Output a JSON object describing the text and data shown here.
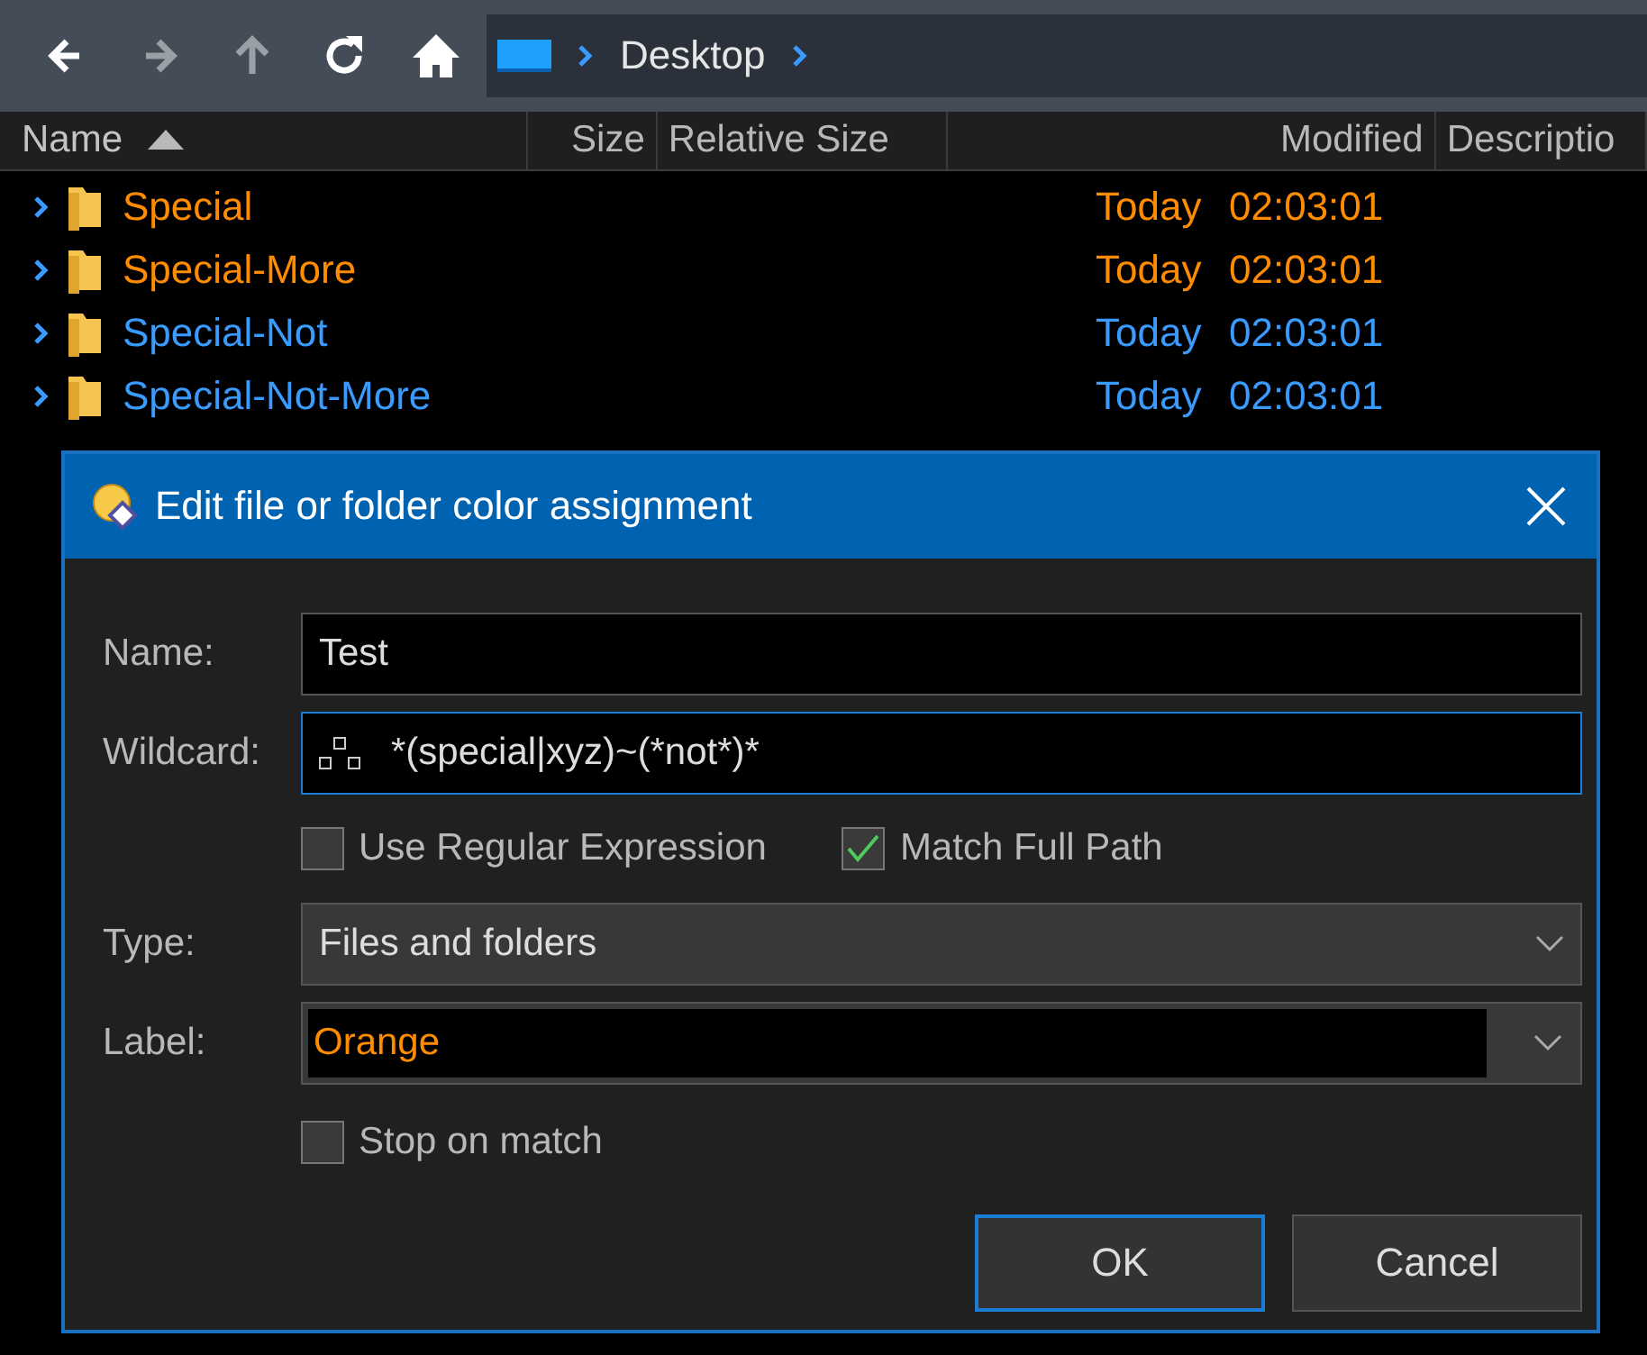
{
  "toolbar": {
    "buttons": [
      {
        "kind": "back",
        "disabled": false
      },
      {
        "kind": "forward",
        "disabled": true
      },
      {
        "kind": "up",
        "disabled": true
      },
      {
        "kind": "refresh",
        "disabled": false
      },
      {
        "kind": "home",
        "disabled": false
      }
    ],
    "breadcrumb": [
      "Desktop"
    ]
  },
  "file_list": {
    "columns": [
      {
        "label": "Name",
        "sorted": true
      },
      {
        "label": "Size",
        "sorted": false
      },
      {
        "label": "Relative Size",
        "sorted": false
      },
      {
        "label": "Modified",
        "sorted": false
      },
      {
        "label": "Descriptio",
        "sorted": false
      }
    ],
    "rows": [
      {
        "name": "Special",
        "day": "Today",
        "time": "02:03:01",
        "color": "#ff8c00"
      },
      {
        "name": "Special-More",
        "day": "Today",
        "time": "02:03:01",
        "color": "#ff8c00"
      },
      {
        "name": "Special-Not",
        "day": "Today",
        "time": "02:03:01",
        "color": "#3a9bff"
      },
      {
        "name": "Special-Not-More",
        "day": "Today",
        "time": "02:03:01",
        "color": "#3a9bff"
      }
    ]
  },
  "dialog": {
    "title": "Edit file or folder color assignment",
    "name_field": {
      "label": "Name:",
      "value": "Test",
      "focused": false
    },
    "wildcard_field": {
      "label": "Wildcard:",
      "value": "*(special|xyz)~(*not*)*",
      "focused": true
    },
    "options": [
      {
        "label": "Use Regular Expression",
        "checked": false
      },
      {
        "label": "Match Full Path",
        "checked": true
      }
    ],
    "type_field": {
      "label": "Type:",
      "value": "Files and folders"
    },
    "label_field": {
      "label": "Label:",
      "value": "Orange",
      "color": "#ff8c00"
    },
    "stop_option": {
      "label": "Stop on match",
      "checked": false
    },
    "buttons": [
      {
        "label": "OK",
        "default": true
      },
      {
        "label": "Cancel",
        "default": false
      }
    ]
  }
}
